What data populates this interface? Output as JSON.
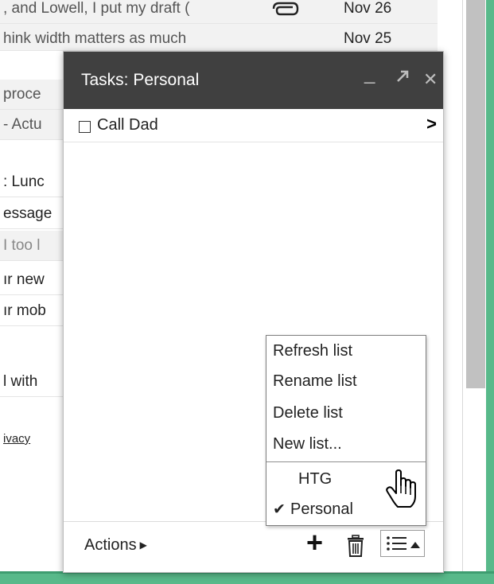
{
  "inbox": {
    "rows": [
      {
        "snippet": ", and Lowell, I put my draft (",
        "date": "Nov 26",
        "attachment": true,
        "style": "read"
      },
      {
        "snippet": "hink width matters as much",
        "date": "Nov 25",
        "attachment": false,
        "style": "read"
      },
      {
        "snippet": "proce",
        "date": "",
        "attachment": false,
        "style": "read"
      },
      {
        "snippet": "- Actu",
        "date": "",
        "attachment": false,
        "style": "read"
      },
      {
        "snippet": ": Lunc",
        "date": "",
        "attachment": false,
        "style": "unread"
      },
      {
        "snippet": "essage",
        "date": "",
        "attachment": false,
        "style": "unread"
      },
      {
        "snippet": "I too l",
        "date": "",
        "attachment": false,
        "style": "read-muted"
      },
      {
        "snippet": "ır new",
        "date": "",
        "attachment": false,
        "style": "unread"
      },
      {
        "snippet": "ır mob",
        "date": "",
        "attachment": false,
        "style": "unread"
      },
      {
        "snippet": "l with",
        "date": "",
        "attachment": false,
        "style": "unread"
      }
    ],
    "footer_link": "ivacy"
  },
  "tasks": {
    "title": "Tasks: Personal",
    "header_icons": [
      "minimize-icon",
      "popout-icon",
      "close-icon"
    ],
    "items": [
      {
        "label": "Call Dad",
        "checked": false
      }
    ],
    "footer": {
      "actions_label": "Actions",
      "add_icon": "plus-icon",
      "delete_icon": "trash-icon",
      "list_icon": "list-menu-icon"
    }
  },
  "menu": {
    "actions": [
      "Refresh list",
      "Rename list",
      "Delete list",
      "New list..."
    ],
    "lists": [
      {
        "label": "HTG",
        "selected": false
      },
      {
        "label": "Personal",
        "selected": true
      }
    ]
  },
  "colors": {
    "header_bg": "#404040",
    "frame_green": "#58b98a",
    "scroll_thumb": "#c1c1c1"
  }
}
